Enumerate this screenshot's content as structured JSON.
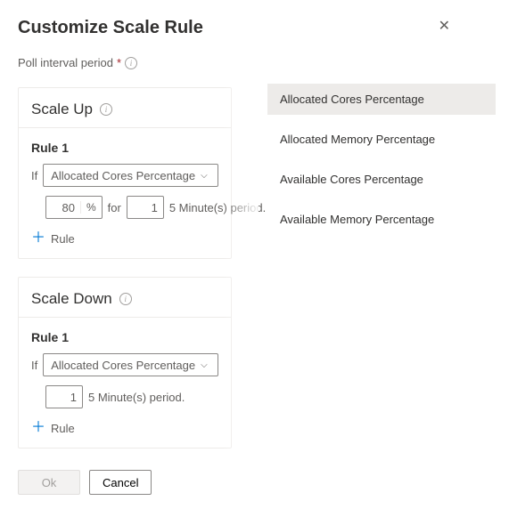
{
  "header": {
    "title": "Customize Scale Rule"
  },
  "poll_label": "Poll interval period",
  "poll_required": "*",
  "scale_up": {
    "title": "Scale Up",
    "rule_title": "Rule 1",
    "if_label": "If",
    "dropdown_value": "Allocated Cores Percentage",
    "threshold_value": "80",
    "threshold_suffix": "%",
    "for_label": "for",
    "duration_value": "1",
    "duration_suffix": "5 Minute(s) period.",
    "add_rule_label": "Rule"
  },
  "scale_down": {
    "title": "Scale Down",
    "rule_title": "Rule 1",
    "if_label": "If",
    "dropdown_value": "Allocated Cores Percentage",
    "duration_value": "1",
    "duration_suffix": "5 Minute(s) period.",
    "add_rule_label": "Rule"
  },
  "footer": {
    "ok": "Ok",
    "cancel": "Cancel"
  },
  "dd_options": [
    "Allocated Cores Percentage",
    "Allocated Memory Percentage",
    "Available Cores Percentage",
    "Available Memory Percentage"
  ]
}
